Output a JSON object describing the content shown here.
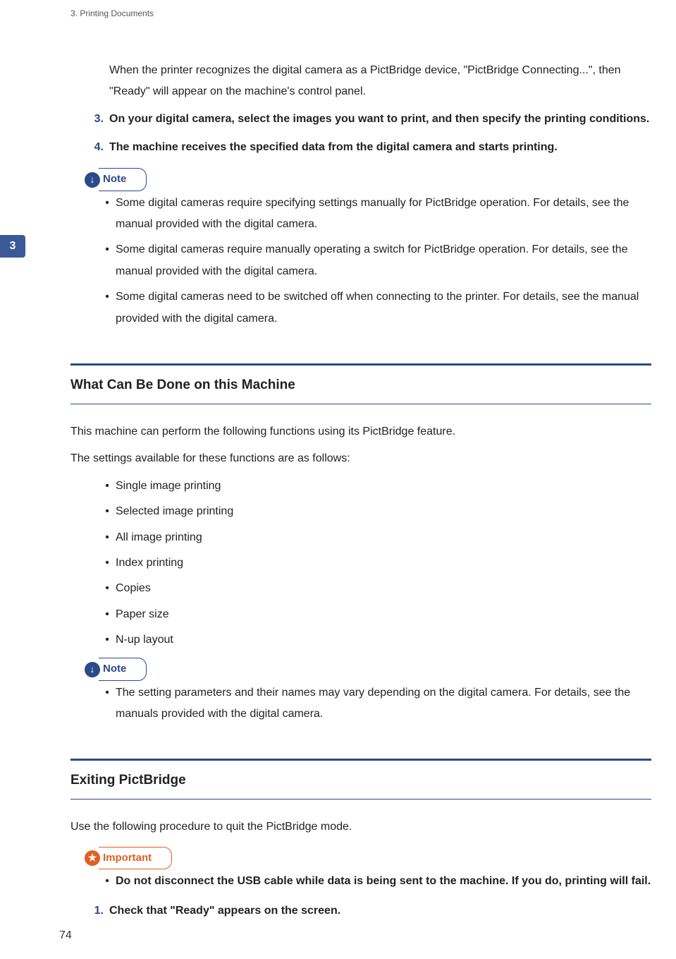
{
  "header": {
    "breadcrumb": "3. Printing Documents"
  },
  "sideTab": "3",
  "intro": "When the printer recognizes the digital camera as a PictBridge device, \"PictBridge Connecting...\", then \"Ready\" will appear on the machine's control panel.",
  "steps": [
    {
      "num": "3.",
      "text": "On your digital camera, select the images you want to print, and then specify the printing conditions."
    },
    {
      "num": "4.",
      "text": "The machine receives the specified data from the digital camera and starts printing."
    }
  ],
  "note1": {
    "label": "Note",
    "items": [
      "Some digital cameras require specifying settings manually for PictBridge operation. For details, see the manual provided with the digital camera.",
      "Some digital cameras require manually operating a switch for PictBridge operation. For details, see the manual provided with the digital camera.",
      "Some digital cameras need to be switched off when connecting to the printer. For details, see the manual provided with the digital camera."
    ]
  },
  "section1": {
    "heading": "What Can Be Done on this Machine",
    "para1": "This machine can perform the following functions using its PictBridge feature.",
    "para2": "The settings available for these functions are as follows:",
    "features": [
      "Single image printing",
      "Selected image printing",
      "All image printing",
      "Index printing",
      "Copies",
      "Paper size",
      "N-up layout"
    ]
  },
  "note2": {
    "label": "Note",
    "items": [
      "The setting parameters and their names may vary depending on the digital camera. For details, see the manuals provided with the digital camera."
    ]
  },
  "section2": {
    "heading": "Exiting PictBridge",
    "para1": "Use the following procedure to quit the PictBridge mode."
  },
  "important": {
    "label": "Important",
    "items": [
      "Do not disconnect the USB cable while data is being sent to the machine. If you do, printing will fail."
    ]
  },
  "steps2": [
    {
      "num": "1.",
      "text": "Check that \"Ready\" appears on the screen."
    }
  ],
  "pageNumber": "74"
}
